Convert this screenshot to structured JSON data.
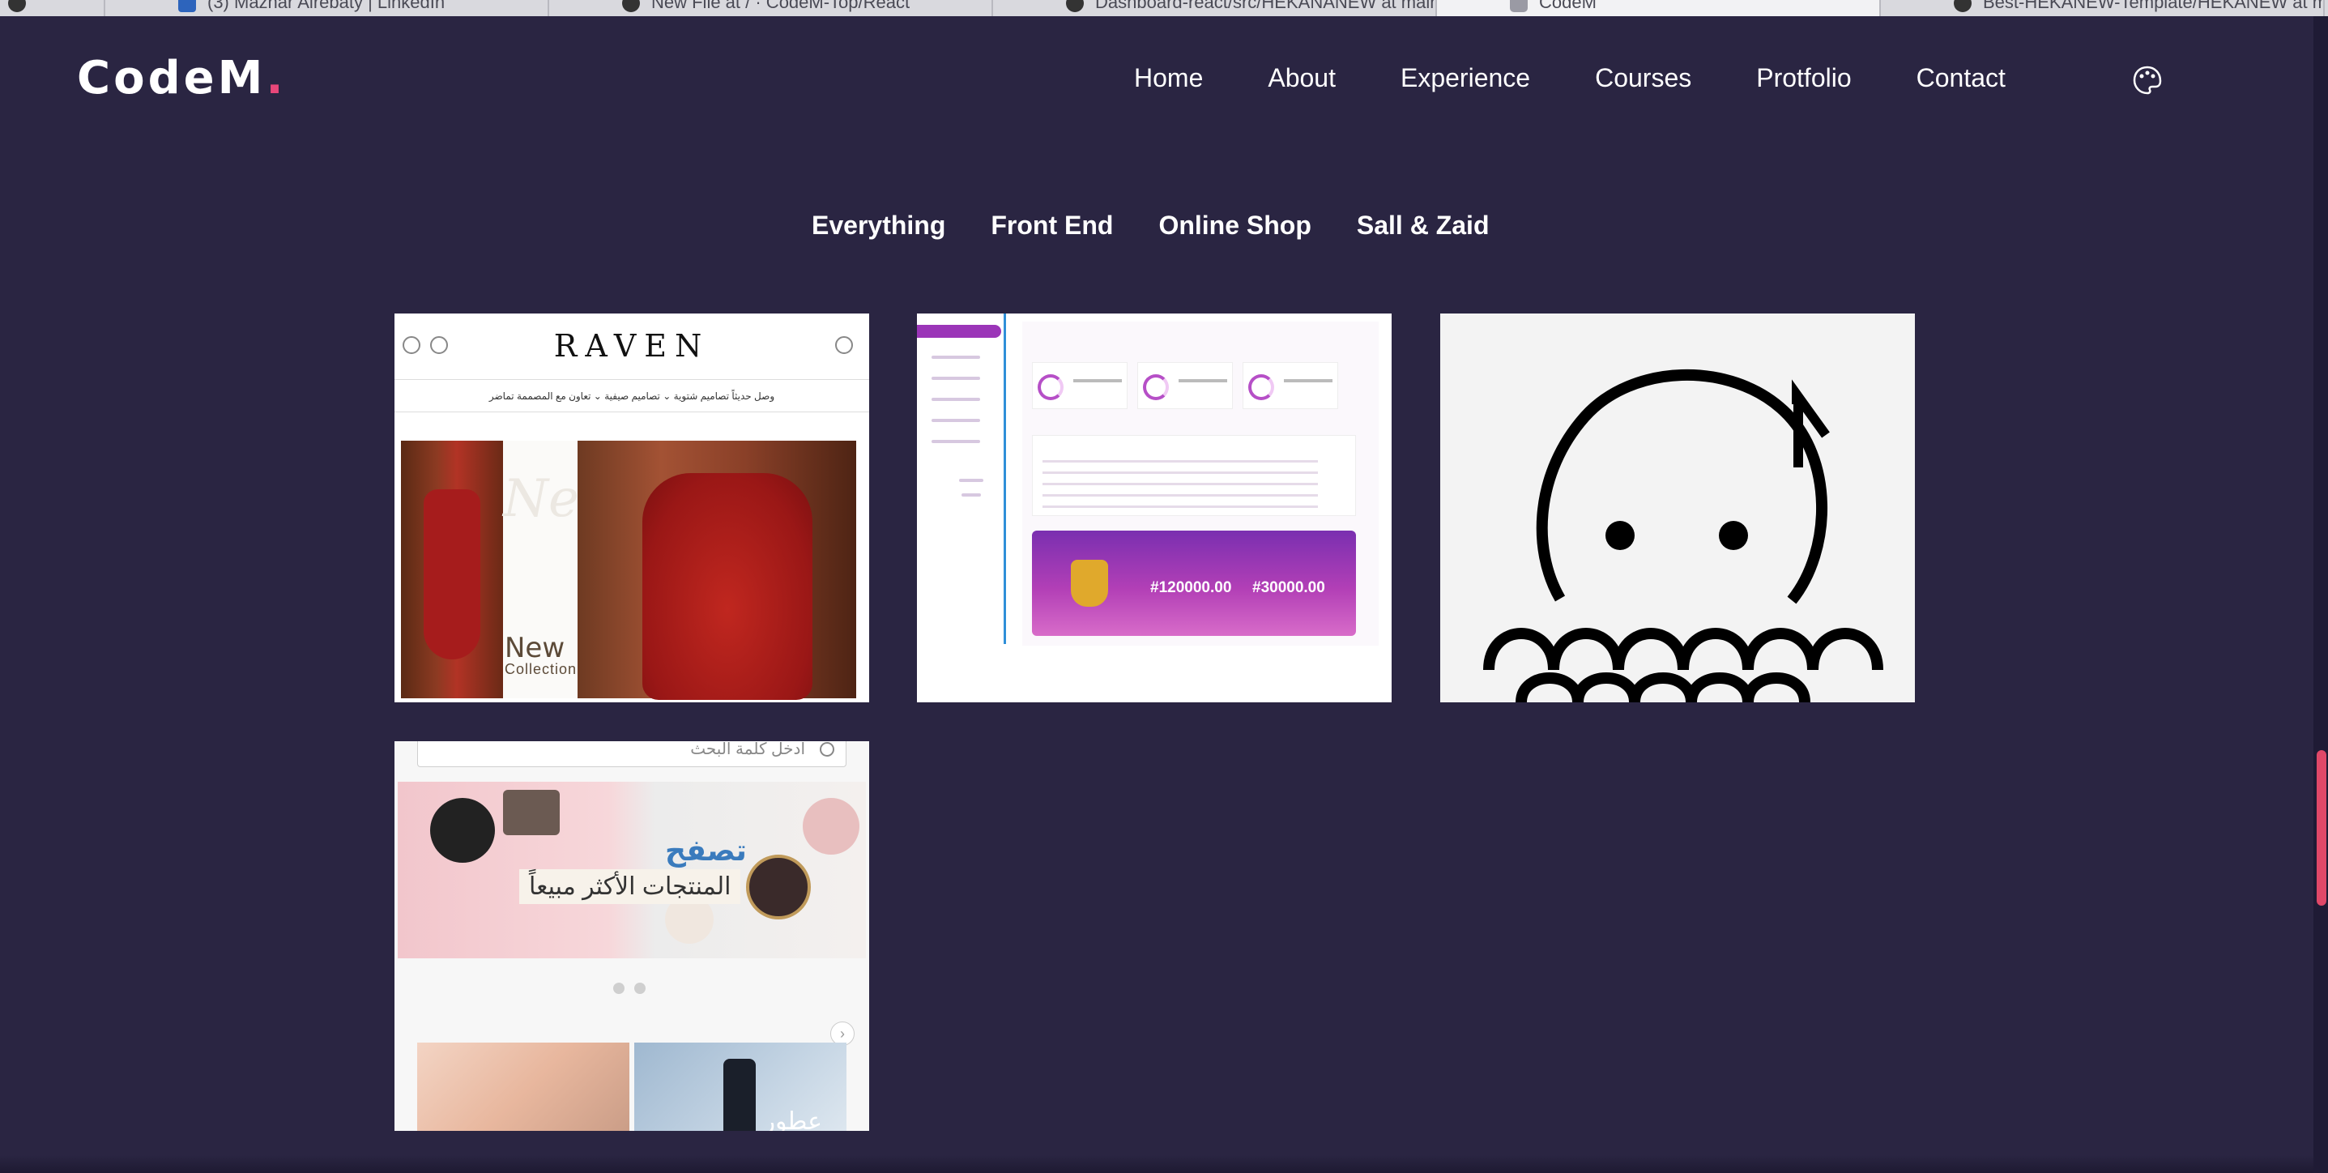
{
  "browser": {
    "tabs": [
      {
        "title": ""
      },
      {
        "title": "(3) Mazhar Alrebaty | LinkedIn"
      },
      {
        "title": "New File at / · CodeM-Top/React"
      },
      {
        "title": "Dashboard-react/src/HEKANANEW at main"
      },
      {
        "title": "CodeM"
      },
      {
        "title": "Best-HEKANEW-Template/HEKANEW at main"
      }
    ]
  },
  "header": {
    "logo": "CodeM",
    "logo_dot": ".",
    "nav": [
      "Home",
      "About",
      "Experience",
      "Courses",
      "Protfolio",
      "Contact"
    ],
    "theme_icon": "palette-icon"
  },
  "filters": [
    "Everything",
    "Front End",
    "Online Shop",
    "Sall & Zaid"
  ],
  "cards": {
    "raven": {
      "brand": "RAVEN",
      "menu": "وصل حديثاً   تصاميم شتوية ⌄   تصاميم صيفية ⌄   تعاون مع المصممة تماضر",
      "ghost": "New",
      "new_label": "New",
      "collection_label": "Collection"
    },
    "dashboard": {
      "amount_1": "#120000.00",
      "amount_2": "#30000.00"
    },
    "shop": {
      "search_placeholder": "ادخل كلمة البحث",
      "banner_title": "تصفح",
      "banner_subtitle": "المنتجات الأكثر مبيعاً",
      "thumb_text": "عطور"
    }
  },
  "colors": {
    "background": "#2a2542",
    "accent": "#e8477a",
    "scroll_thumb": "#e04868"
  }
}
